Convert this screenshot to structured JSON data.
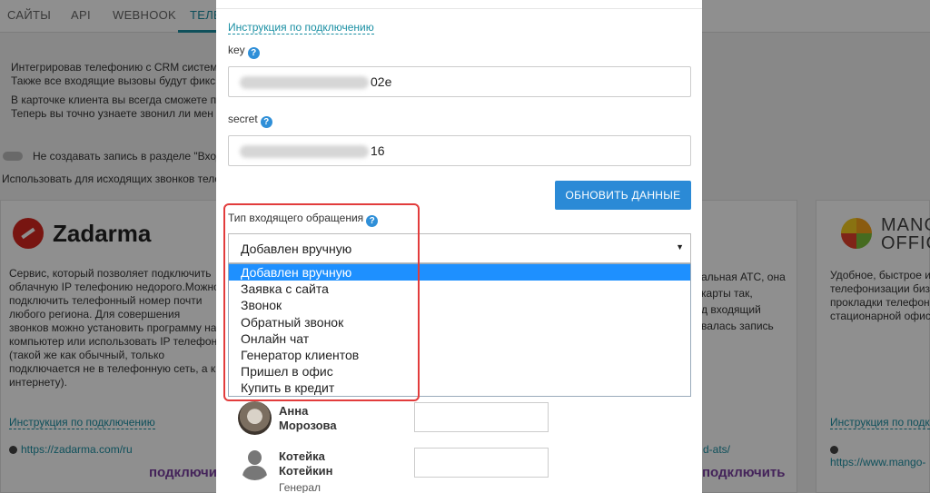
{
  "tabs": [
    "САЙТЫ",
    "API",
    "WEBHOOK",
    "ТЕЛЕ"
  ],
  "background": {
    "intro_lines": [
      "Интегрировав телефонию с CRM систем",
      "Также все входящие вызовы будут фикс",
      "В карточке клиента вы всегда сможете п",
      "Теперь вы точно узнаете звонил ли мен"
    ],
    "toggle_label": "Не создавать запись в разделе \"Вход",
    "outgoing_label": "Использовать для исходящих звонков теле",
    "zadarma": {
      "logo_text": "Zadarma",
      "description": "Сервис, который позволяет подключить облачную IP телефонию недорого.Можно подключить телефонный номер почти любого региона. Для совершения звонков можно установить программу на компьютер или использовать IP телефон (такой же как обычный, только подключается не в телефонную сеть, а к интернету).",
      "instr_link": "Инструкция по подключению",
      "url": "https://zadarma.com/ru",
      "connect": "подключи"
    },
    "middle": {
      "lines": [
        "альная АТС, она",
        "карты так,",
        "д входящий",
        "валась запись"
      ],
      "url_tail": "d-ats/",
      "connect": "подключить"
    },
    "mango": {
      "logo_text_1": "MANG",
      "logo_text_2": "OFFIC",
      "description": "Удобное, быстрое и телефонизации биз прокладки телефон стационарной офис",
      "instr_link": "Инструкция по подк",
      "url": "https://www.mango-"
    }
  },
  "modal": {
    "instr_link": "Инструкция по подключению",
    "key_label": "key",
    "key_value_tail": "02e",
    "secret_label": "secret",
    "secret_value_tail": "16",
    "update_button": "ОБНОВИТЬ ДАННЫЕ",
    "type_label": "Тип входящего обращения",
    "select_value": "Добавлен вручную",
    "options": [
      "Добавлен вручную",
      "Заявка с сайта",
      "Звонок",
      "Обратный звонок",
      "Онлайн чат",
      "Генератор клиентов",
      "Пришел в офис",
      "Купить в кредит"
    ],
    "selected_option": "Добавлен вручную",
    "users": [
      {
        "name": "Анна Морозова",
        "role": ""
      },
      {
        "name": "Котейка",
        "name2": "Котейкин",
        "role": "Генерал котов"
      }
    ]
  },
  "colors": {
    "accent": "#1a8fa3",
    "button": "#2b8ad6",
    "selected_option": "#1e90ff",
    "highlight_frame": "#e23c3c"
  }
}
